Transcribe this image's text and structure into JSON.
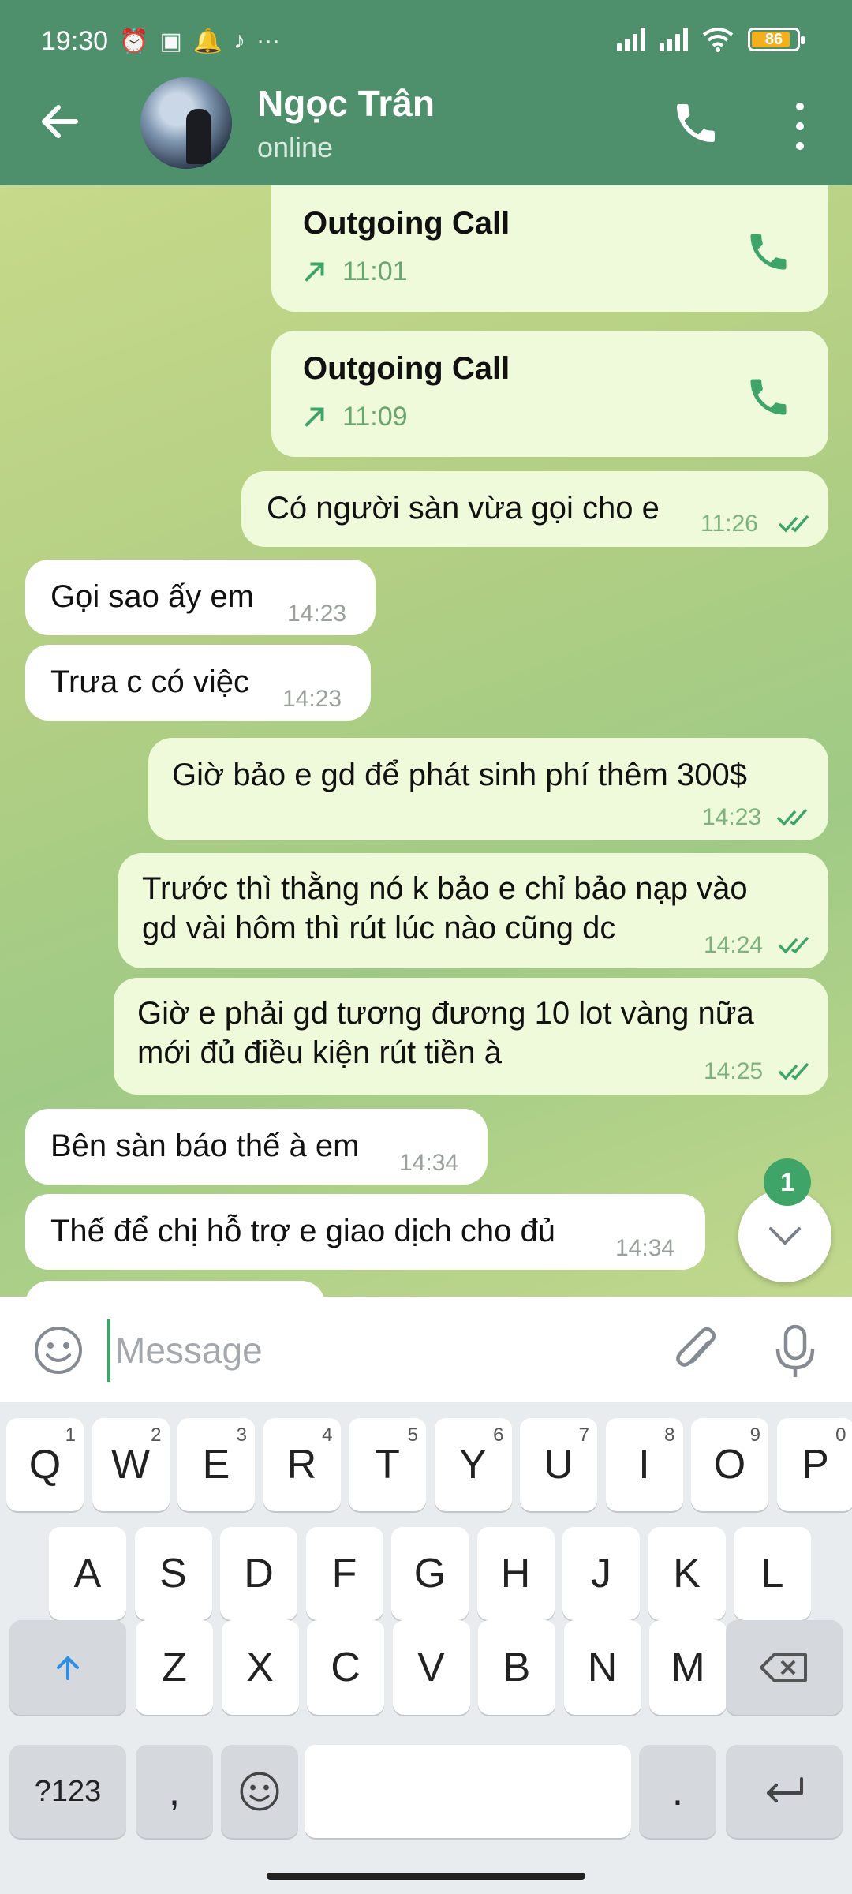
{
  "status_bar": {
    "time": "19:30",
    "battery": "86"
  },
  "header": {
    "name": "Ngọc Trân",
    "status": "online"
  },
  "messages": {
    "call1": {
      "title": "Outgoing Call",
      "time": "11:01"
    },
    "call2": {
      "title": "Outgoing Call",
      "time": "11:09"
    },
    "m1": {
      "text": "Có người sàn vừa gọi cho e",
      "time": "11:26"
    },
    "m2": {
      "text": "Gọi sao ấy em",
      "time": "14:23"
    },
    "m3": {
      "text": "Trưa c có việc",
      "time": "14:23"
    },
    "m4": {
      "text": "Giờ bảo e gd để phát sinh phí thêm 300$",
      "time": "14:23"
    },
    "m5": {
      "line1": "Trước thì thằng nó k bảo e chỉ bảo nạp vào",
      "line2": "gd vài hôm thì rút lúc nào cũng dc",
      "time": "14:24"
    },
    "m6": {
      "line1": "Giờ e phải gd tương đương 10 lot vàng nữa",
      "line2": "mới đủ điều kiện rút tiền à",
      "time": "14:25"
    },
    "m7": {
      "text": "Bên sàn báo thế à em",
      "time": "14:34"
    },
    "m8": {
      "text": "Thế để chị hỗ trợ e giao dịch cho đủ",
      "time": "14:34"
    }
  },
  "scroll_badge": "1",
  "input": {
    "placeholder": "Message"
  },
  "keyboard": {
    "row1": [
      "Q",
      "W",
      "E",
      "R",
      "T",
      "Y",
      "U",
      "I",
      "O",
      "P"
    ],
    "row1_hints": [
      "1",
      "2",
      "3",
      "4",
      "5",
      "6",
      "7",
      "8",
      "9",
      "0"
    ],
    "row2": [
      "A",
      "S",
      "D",
      "F",
      "G",
      "H",
      "J",
      "K",
      "L"
    ],
    "row3": [
      "Z",
      "X",
      "C",
      "V",
      "B",
      "N",
      "M"
    ],
    "symbols": "?123",
    "comma": ",",
    "period": "."
  },
  "colors": {
    "header": "#4e8f6c",
    "outgoing_bubble": "#eefad9",
    "incoming_bubble": "#ffffff",
    "accent": "#3fa468"
  }
}
